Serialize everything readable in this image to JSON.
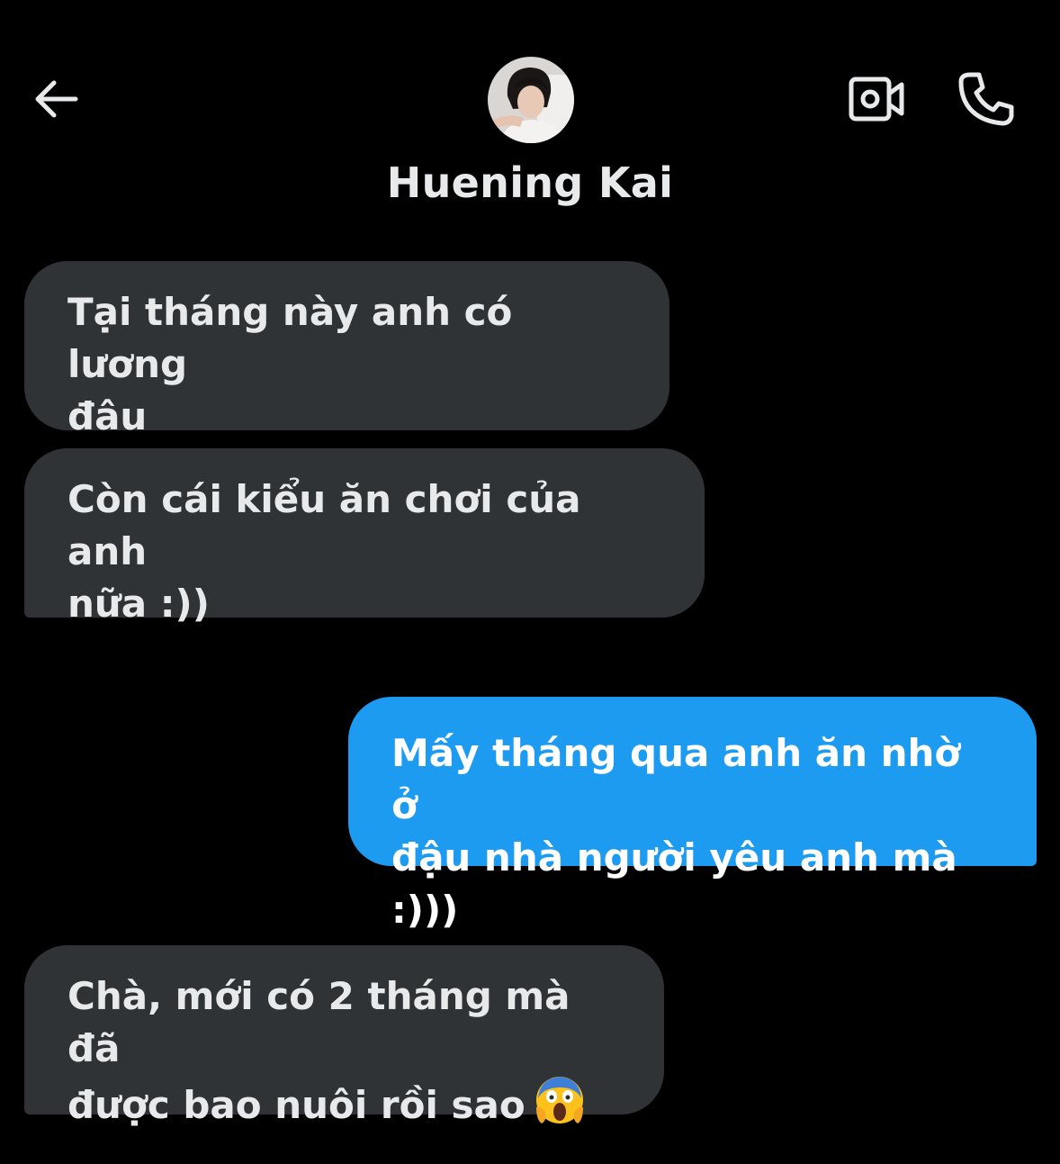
{
  "header": {
    "contact_name": "Huening Kai",
    "back_icon": "arrow-left-icon",
    "video_icon": "video-camera-icon",
    "call_icon": "phone-icon"
  },
  "colors": {
    "background": "#000000",
    "incoming_bubble": "#2f3336",
    "outgoing_bubble": "#1d9bf0",
    "text": "#e7e9ea"
  },
  "messages": [
    {
      "direction": "incoming",
      "text": "Tại tháng này anh có lương\nđâu"
    },
    {
      "direction": "incoming",
      "text": "Còn cái kiểu ăn chơi của anh\nnữa :))"
    },
    {
      "direction": "outgoing",
      "text": "Mấy tháng qua anh ăn nhờ ở\nđậu nhà người yêu anh mà :)))"
    },
    {
      "direction": "incoming",
      "text": "Chà, mới có 2 tháng mà đã\nđược bao nuôi rồi sao",
      "emoji": "face-screaming-in-fear-icon"
    }
  ]
}
